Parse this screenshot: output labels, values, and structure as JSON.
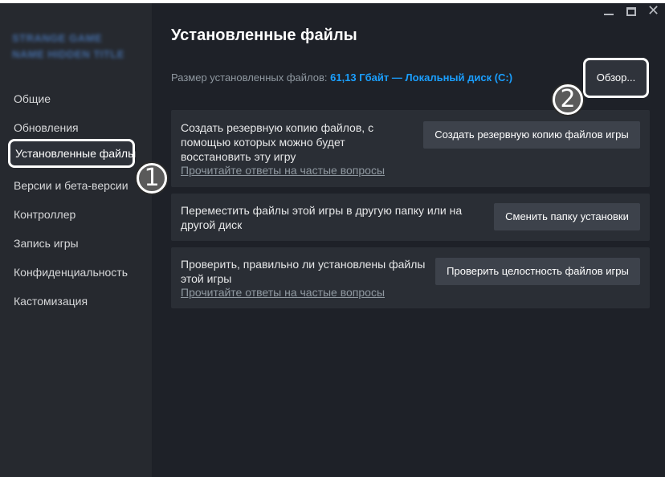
{
  "window": {
    "minimize_icon": "minimize-icon",
    "maximize_icon": "maximize-icon",
    "close_glyph": "✕"
  },
  "sidebar": {
    "game_title": "STRANGE GAME NAME HIDDEN TITLE",
    "items": [
      {
        "label": "Общие"
      },
      {
        "label": "Обновления"
      },
      {
        "label": "Установленные файлы",
        "active": true
      },
      {
        "label": "Версии и бета-версии"
      },
      {
        "label": "Контроллер"
      },
      {
        "label": "Запись игры"
      },
      {
        "label": "Конфиденциальность"
      },
      {
        "label": "Кастомизация"
      }
    ]
  },
  "main": {
    "title": "Установленные файлы",
    "size_label": "Размер установленных файлов:",
    "size_value": "61,13 Гбайт",
    "size_separator": "—",
    "size_disk": "Локальный диск (C:)",
    "browse_button": "Обзор...",
    "cards": [
      {
        "text_lines": [
          "Создать резервную копию файлов, с",
          "помощью которых можно будет",
          "восстановить эту игру"
        ],
        "link": "Прочитайте ответы на частые вопросы",
        "button": "Создать резервную копию файлов игры"
      },
      {
        "text_lines": [
          "Переместить файлы этой игры в другую папку или на",
          "другой диск"
        ],
        "button": "Сменить папку установки"
      },
      {
        "text_lines": [
          "Проверить, правильно ли установлены файлы",
          "этой игры"
        ],
        "link": "Прочитайте ответы на частые вопросы",
        "button": "Проверить целостность файлов игры"
      }
    ]
  },
  "annotations": {
    "badge_1": "1",
    "badge_2": "2"
  },
  "colors": {
    "accent": "#1a9fff",
    "background": "#1e2128",
    "sidebar": "#26292f",
    "card": "#2a2e35",
    "button": "#3d424b"
  }
}
